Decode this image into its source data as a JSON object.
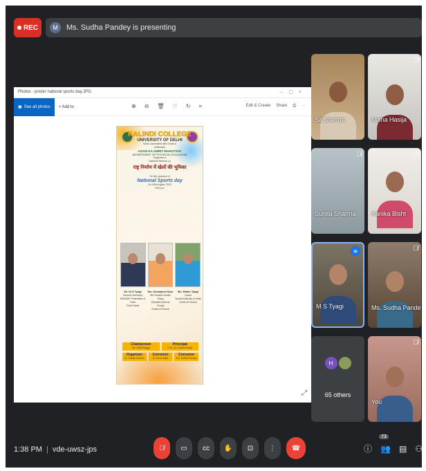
{
  "meeting": {
    "rec_label": "REC",
    "presenter_initial": "M",
    "presenting_text": "Ms. Sudha Pandey is presenting",
    "time": "1:38 PM",
    "separator": "|",
    "meeting_code": "vde-uwsz-jps",
    "participants_count": "73"
  },
  "shared_window": {
    "title": "Photos - poster national sports day.JPG",
    "see_all_photos": "See all photos",
    "add_to": "+ Add to",
    "edit_create": "Edit & Create",
    "share": "Share"
  },
  "poster": {
    "college": "KALINDI COLLEGE",
    "university": "UNIVERSITY OF DELHI",
    "accreditation": "NAAC Accredited with Grade A",
    "celebrates": "celebrates",
    "azadi": "AZADI KA AMRIT MAHOTSAV",
    "department": "DEPARTMENT OF PHYSICAL EDUCATION",
    "organises": "Organises a",
    "webinar": "National Webinar on",
    "hindi_title": "राष्ट्र निर्माण में खेलों की भूमिका",
    "occasion": "On the occasion of",
    "sports_day": "National Sports day",
    "date": "On 29th August, 2022",
    "time": "3:00 p.m.",
    "speakers": [
      {
        "name": "Mr. M.S Tyagi",
        "line1": "General Secretary",
        "line2": "RAILWAY Federation of India",
        "role": "Chief Guest"
      },
      {
        "name": "Ms. Kamaljeet Kaur",
        "line1": "5th Position Holder Tokyo",
        "line2": "Olympics (Discus Throw)",
        "role": "Guest of Honour"
      },
      {
        "name": "Ms. Rakhi Tyagi",
        "line1": "Coach",
        "line2": "Sports Authority of India",
        "role": "Guest of Honour"
      }
    ],
    "roles": [
      {
        "title": "Chairperson",
        "name": "Ms. Rajni Bagga"
      },
      {
        "title": "Principal",
        "name": "Prof. (Dr.) Naina Hasija"
      },
      {
        "title": "Organiser",
        "name": "Dr. Sunita Sharma"
      },
      {
        "title": "Convener",
        "name": "Dr. Renu Mala"
      },
      {
        "title": "Convener",
        "name": "Ms. Sudha Pandey"
      }
    ]
  },
  "participants": [
    {
      "name": "Sa sharma",
      "muted": false
    },
    {
      "name": "Naina Hasija",
      "muted": true
    },
    {
      "name": "Sunita Sharma",
      "muted": true
    },
    {
      "name": "Kanika Bisht",
      "muted": true
    },
    {
      "name": "M S Tyagi",
      "muted": false,
      "speaking": true
    },
    {
      "name": "Ms. Sudha Pandey",
      "muted": true
    },
    {
      "name": "65 others",
      "initial": "H"
    },
    {
      "name": "You",
      "muted": true
    }
  ],
  "icons": {
    "mic_off": "mic-off-icon",
    "camera": "camera-icon",
    "captions": "captions-icon",
    "hand": "raise-hand-icon",
    "present": "present-icon",
    "more": "more-options-icon",
    "end_call": "end-call-icon",
    "info": "info-icon",
    "people": "people-icon",
    "chat": "chat-icon",
    "activities": "activities-icon"
  },
  "colors": {
    "background": "#202124",
    "rec_red": "#d93025",
    "end_call_red": "#ea4335",
    "speaking_blue": "#1a73e8"
  }
}
